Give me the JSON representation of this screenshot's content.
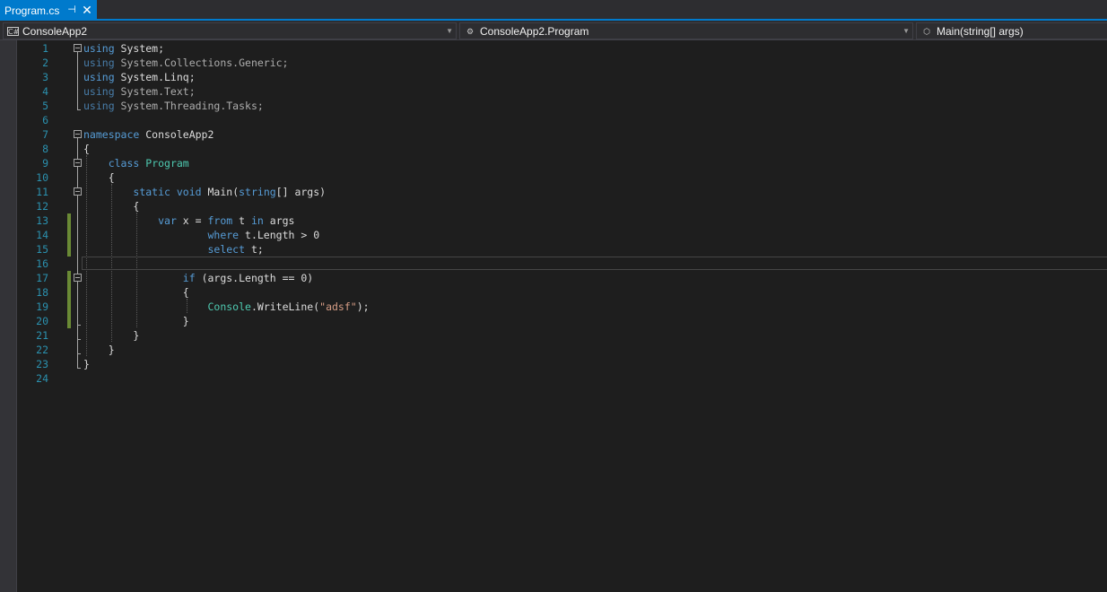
{
  "tab": {
    "title": "Program.cs",
    "pin_glyph": "⊣",
    "close_glyph": "✕"
  },
  "navbar": {
    "project": {
      "icon": "C#",
      "label": "ConsoleApp2"
    },
    "type": {
      "icon": "⚙",
      "label": "ConsoleApp2.Program"
    },
    "member": {
      "icon": "⬡",
      "label": "Main(string[] args)"
    },
    "arrow_glyph": "▼"
  },
  "editor": {
    "line_numbers": [
      "1",
      "2",
      "3",
      "4",
      "5",
      "6",
      "7",
      "8",
      "9",
      "10",
      "11",
      "12",
      "13",
      "14",
      "15",
      "16",
      "17",
      "18",
      "19",
      "20",
      "21",
      "22",
      "23",
      "24"
    ],
    "lines": [
      {
        "indent": "",
        "tokens": [
          {
            "t": "kw",
            "v": "using"
          },
          {
            "t": "plain",
            "v": " System;"
          }
        ]
      },
      {
        "indent": "",
        "faded": true,
        "tokens": [
          {
            "t": "kw",
            "v": "using"
          },
          {
            "t": "plain",
            "v": " System.Collections.Generic;"
          }
        ]
      },
      {
        "indent": "",
        "tokens": [
          {
            "t": "kw",
            "v": "using"
          },
          {
            "t": "plain",
            "v": " System.Linq;"
          }
        ]
      },
      {
        "indent": "",
        "faded": true,
        "tokens": [
          {
            "t": "kw",
            "v": "using"
          },
          {
            "t": "plain",
            "v": " System.Text;"
          }
        ]
      },
      {
        "indent": "",
        "faded": true,
        "tokens": [
          {
            "t": "kw",
            "v": "using"
          },
          {
            "t": "plain",
            "v": " System.Threading.Tasks;"
          }
        ]
      },
      {
        "indent": "",
        "tokens": []
      },
      {
        "indent": "",
        "tokens": [
          {
            "t": "kw",
            "v": "namespace"
          },
          {
            "t": "plain",
            "v": " ConsoleApp2"
          }
        ]
      },
      {
        "indent": "",
        "tokens": [
          {
            "t": "plain",
            "v": "{"
          }
        ]
      },
      {
        "indent": "    ",
        "tokens": [
          {
            "t": "kw",
            "v": "class"
          },
          {
            "t": "plain",
            "v": " "
          },
          {
            "t": "ty",
            "v": "Program"
          }
        ]
      },
      {
        "indent": "    ",
        "tokens": [
          {
            "t": "plain",
            "v": "{"
          }
        ]
      },
      {
        "indent": "        ",
        "tokens": [
          {
            "t": "kw",
            "v": "static"
          },
          {
            "t": "plain",
            "v": " "
          },
          {
            "t": "kw",
            "v": "void"
          },
          {
            "t": "plain",
            "v": " Main("
          },
          {
            "t": "kw",
            "v": "string"
          },
          {
            "t": "plain",
            "v": "[] args)"
          }
        ]
      },
      {
        "indent": "        ",
        "tokens": [
          {
            "t": "plain",
            "v": "{"
          }
        ]
      },
      {
        "indent": "            ",
        "tokens": [
          {
            "t": "kw",
            "v": "var"
          },
          {
            "t": "plain",
            "v": " x = "
          },
          {
            "t": "kw",
            "v": "from"
          },
          {
            "t": "plain",
            "v": " t "
          },
          {
            "t": "kw",
            "v": "in"
          },
          {
            "t": "plain",
            "v": " args"
          }
        ]
      },
      {
        "indent": "                    ",
        "tokens": [
          {
            "t": "kw",
            "v": "where"
          },
          {
            "t": "plain",
            "v": " t.Length > 0"
          }
        ]
      },
      {
        "indent": "                    ",
        "tokens": [
          {
            "t": "kw",
            "v": "select"
          },
          {
            "t": "plain",
            "v": " t;"
          }
        ]
      },
      {
        "indent": "",
        "tokens": []
      },
      {
        "indent": "                ",
        "tokens": [
          {
            "t": "kw",
            "v": "if"
          },
          {
            "t": "plain",
            "v": " (args.Length == 0)"
          }
        ]
      },
      {
        "indent": "                ",
        "tokens": [
          {
            "t": "plain",
            "v": "{"
          }
        ]
      },
      {
        "indent": "                    ",
        "tokens": [
          {
            "t": "ty",
            "v": "Console"
          },
          {
            "t": "plain",
            "v": "."
          },
          {
            "t": "plain",
            "v": "WriteLine("
          },
          {
            "t": "str",
            "v": "\"adsf\""
          },
          {
            "t": "plain",
            "v": ");"
          }
        ]
      },
      {
        "indent": "                ",
        "tokens": [
          {
            "t": "plain",
            "v": "}"
          }
        ]
      },
      {
        "indent": "        ",
        "tokens": [
          {
            "t": "plain",
            "v": "}"
          }
        ]
      },
      {
        "indent": "    ",
        "tokens": [
          {
            "t": "plain",
            "v": "}"
          }
        ]
      },
      {
        "indent": "",
        "tokens": [
          {
            "t": "plain",
            "v": "}"
          }
        ]
      },
      {
        "indent": "",
        "tokens": []
      }
    ],
    "colors": {
      "keyword": "#569cd6",
      "type": "#4ec9b0",
      "string": "#d69d85",
      "text": "#dcdcdc",
      "line_number": "#2b91af",
      "changed": "#6a8a35"
    }
  }
}
